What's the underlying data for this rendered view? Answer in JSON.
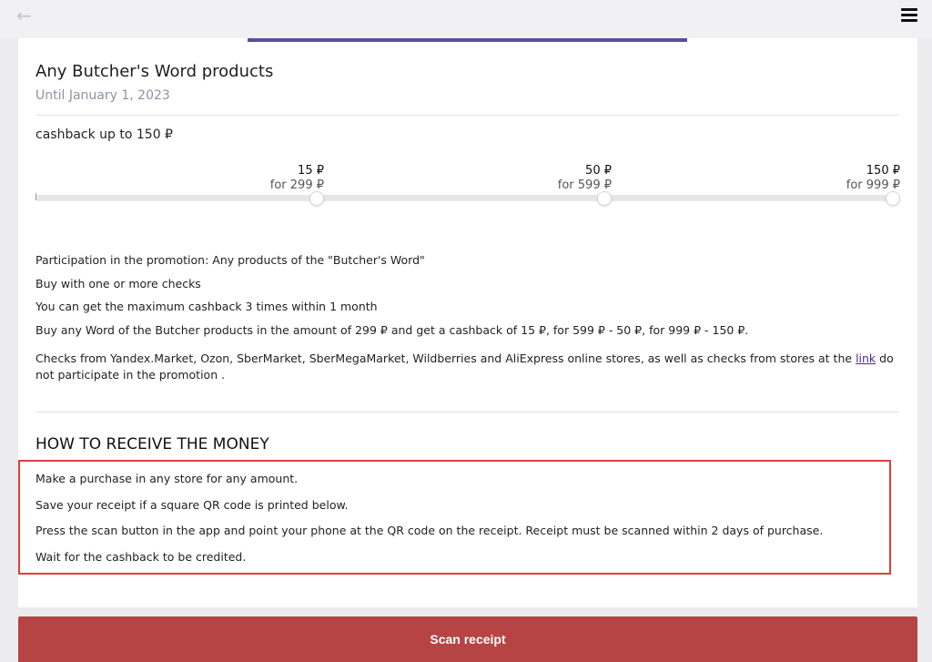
{
  "header": {
    "back_icon": "arrow-left-icon",
    "menu_icon": "hamburger-menu-icon"
  },
  "offer": {
    "title": "Any Butcher's Word products",
    "until": "Until January 1, 2023",
    "cashback_label": "cashback up to 150 ₽",
    "tiers": [
      {
        "amount": "15 ₽",
        "condition": "for 299 ₽"
      },
      {
        "amount": "50 ₽",
        "condition": "for 599 ₽"
      },
      {
        "amount": "150 ₽",
        "condition": "for 999 ₽"
      }
    ],
    "rules": [
      "Participation in the promotion: Any products of the \"Butcher's Word\"",
      "Buy with one or more checks",
      "You can get the maximum cashback 3 times within 1 month",
      "Buy any Word of the Butcher products in the amount of 299 ₽ and get a cashback of 15 ₽, for 599 ₽ - 50 ₽, for 999 ₽ - 150 ₽."
    ],
    "exclusion_text_before": "Checks from Yandex.Market, Ozon, SberMarket, SberMegaMarket, Wildberries and AliExpress online stores, as well as checks from stores at the",
    "exclusion_link": "link",
    "exclusion_text_after": "do not participate in the promotion ."
  },
  "how_to": {
    "title": "HOW TO RECEIVE THE MONEY",
    "steps": [
      "Make a purchase in any store for any amount.",
      "Save your receipt if a square QR code is printed below.",
      "Press the scan button in the app and point your phone at the QR code on the receipt. Receipt must be scanned within 2 days of purchase.",
      "Wait for the cashback to be credited."
    ]
  },
  "actions": {
    "scan_label": "Scan receipt"
  },
  "colors": {
    "accent": "#574fa0",
    "scan_button": "#b64444",
    "highlight_border": "#e03d3d",
    "muted_date": "#8a94a6"
  }
}
